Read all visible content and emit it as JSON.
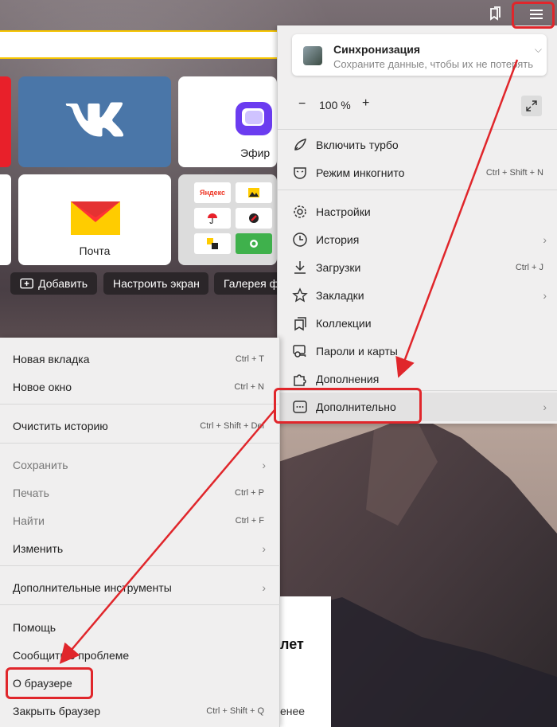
{
  "colors": {
    "accent_yellow": "#f5c400",
    "highlight_red": "#e0262b",
    "vk_blue": "#4a76a8",
    "menu_bg": "#f0efef"
  },
  "tiles": {
    "vk": {
      "icon": "vk-logo-icon"
    },
    "efir": {
      "label": "Эфир",
      "icon": "efir-logo-icon"
    },
    "pochta": {
      "label": "Почта",
      "icon": "mail-envelope-icon"
    },
    "group": {
      "yandex_text": "Яндекс"
    }
  },
  "bottom_buttons": {
    "add": "Добавить",
    "customize": "Настроить экран",
    "gallery": "Галерея ф"
  },
  "sync": {
    "title": "Синхронизация",
    "subtitle": "Сохраните данные, чтобы их не потерять"
  },
  "zoom": {
    "minus": "−",
    "value": "100 %",
    "plus": "+"
  },
  "main_menu": {
    "turbo": "Включить турбо",
    "incognito": "Режим инкогнито",
    "incognito_shortcut": "Ctrl + Shift + N",
    "settings": "Настройки",
    "history": "История",
    "downloads": "Загрузки",
    "downloads_shortcut": "Ctrl + J",
    "bookmarks": "Закладки",
    "collections": "Коллекции",
    "passwords": "Пароли и карты",
    "extensions": "Дополнения",
    "more": "Дополнительно"
  },
  "sub_menu": {
    "new_tab": "Новая вкладка",
    "new_tab_shortcut": "Ctrl + T",
    "new_window": "Новое окно",
    "new_window_shortcut": "Ctrl + N",
    "clear_history": "Очистить историю",
    "clear_history_shortcut": "Ctrl + Shift + Del",
    "save": "Сохранить",
    "print": "Печать",
    "print_shortcut": "Ctrl + P",
    "find": "Найти",
    "find_shortcut": "Ctrl + F",
    "edit": "Изменить",
    "dev_tools": "Дополнительные инструменты",
    "help": "Помощь",
    "report": "Сообщить о проблеме",
    "about": "О браузере",
    "close": "Закрыть браузер",
    "close_shortcut": "Ctrl + Shift + Q"
  },
  "news_card": {
    "headline_fragment": "лет",
    "text_fragment": "енее"
  }
}
